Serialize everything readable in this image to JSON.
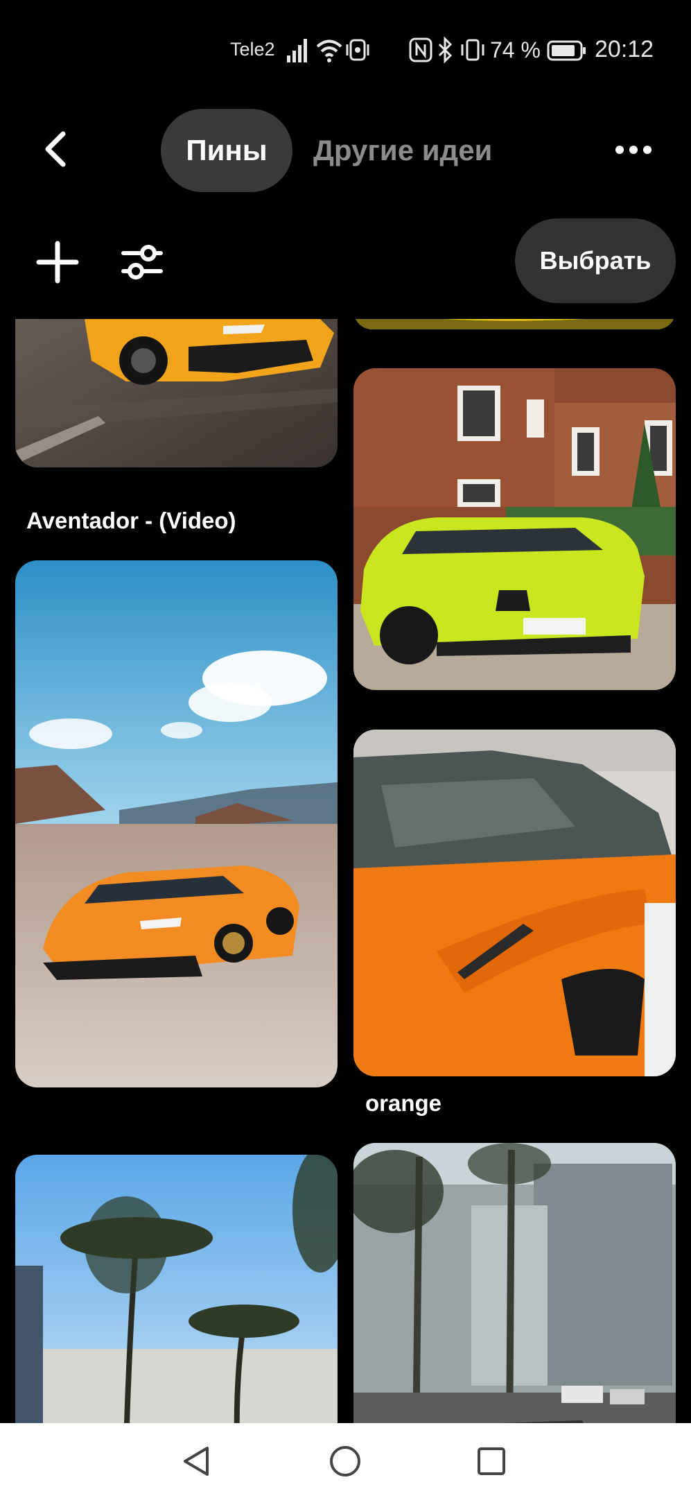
{
  "status_bar": {
    "carrier": "Tele2",
    "battery_percent": "74 %",
    "time": "20:12",
    "icons": [
      "signal-icon",
      "wifi-icon",
      "vibration-app-icon",
      "nfc-icon",
      "bluetooth-icon",
      "vibrate-icon",
      "battery-icon"
    ]
  },
  "header": {
    "tabs": [
      {
        "label": "Пины",
        "active": true
      },
      {
        "label": "Другие идеи",
        "active": false
      }
    ],
    "back_icon": "back-arrow-icon",
    "more_icon": "more-icon"
  },
  "toolbar": {
    "add_icon": "plus-icon",
    "filter_icon": "filter-sliders-icon",
    "select_label": "Выбрать"
  },
  "pins": [
    {
      "caption": "Aventador - (Video)",
      "subject": "orange Lamborghini Aventador on road"
    },
    {
      "caption": "",
      "subject": "yellow car (partially visible)"
    },
    {
      "caption": "",
      "subject": "lime green BMW M4 in front of brick building"
    },
    {
      "caption": "",
      "subject": "orange Lamborghini Huracan in desert"
    },
    {
      "caption": "orange",
      "subject": "orange McLaren convertible"
    },
    {
      "caption": "",
      "subject": "palm trees under blue sky"
    },
    {
      "caption": "",
      "subject": "street with palm trees and buildings"
    }
  ],
  "nav_bar": {
    "icons": [
      "back-triangle-icon",
      "home-circle-icon",
      "recents-square-icon"
    ]
  },
  "colors": {
    "background": "#000000",
    "active_tab_bg": "#3a3a3a",
    "inactive_tab_text": "#8c8c8c",
    "select_button_bg": "#333333",
    "nav_bar_bg": "#ffffff"
  }
}
